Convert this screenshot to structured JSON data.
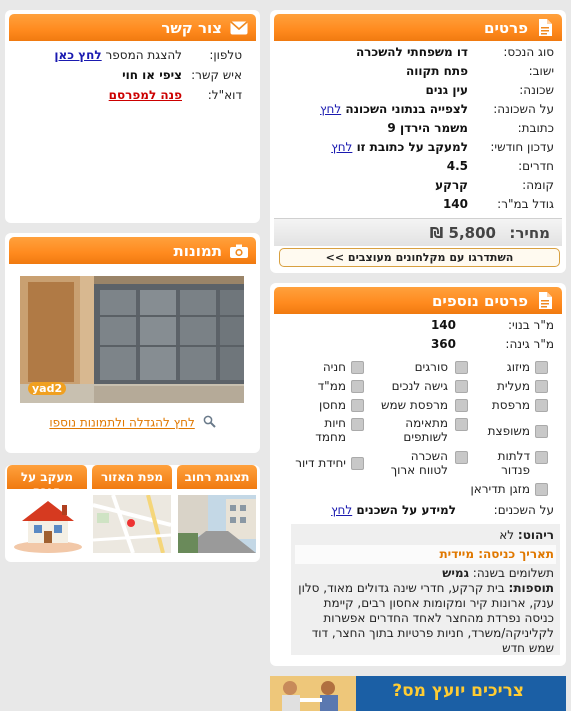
{
  "details": {
    "title": "פרטים",
    "rows": [
      {
        "label": "סוג הנכס:",
        "value": "דו משפחתי להשכרה"
      },
      {
        "label": "ישוב:",
        "value": "פתח תקווה"
      },
      {
        "label": "שכונה:",
        "value": "עין גנים"
      },
      {
        "label": "על השכונה:",
        "value": "לצפייה בנתוני השכונה",
        "link": "לחץ"
      },
      {
        "label": "כתובת:",
        "value": "משמר הירדן 9"
      },
      {
        "label": "עדכון חודשי:",
        "value": "למעקב על כתובת זו",
        "link": "לחץ"
      },
      {
        "label": "חדרים:",
        "value": "4.5"
      },
      {
        "label": "קומה:",
        "value": "קרקע"
      },
      {
        "label": "גודל במ\"ר:",
        "value": "140"
      }
    ],
    "price_label": "מחיר:",
    "price_value": "5,800 ₪",
    "upgrade_link": "השתדרגו עם מקלחונים מעוצבים >>"
  },
  "contact": {
    "title": "צור קשר",
    "phone_label": "טלפון:",
    "phone_text": "להצגת המספר",
    "phone_link": "לחץ כאן",
    "person_label": "איש קשר:",
    "person_value": "ציפי או חוי",
    "email_label": "דוא\"ל:",
    "email_link": "פנה למפרסם"
  },
  "photos": {
    "title": "תמונות",
    "watermark": "yad2",
    "enlarge_link": "לחץ להגדלה ולתמונות נוספו"
  },
  "tabs": [
    {
      "label": "תצוגת רחוב"
    },
    {
      "label": "מפת האזור"
    },
    {
      "label": "מעקב על הנכס"
    }
  ],
  "more": {
    "title": "פרטים נוספים",
    "built_label": "מ\"ר בנוי:",
    "built_value": "140",
    "garden_label": "מ\"ר גינה:",
    "garden_value": "360",
    "features": [
      [
        "מיזוג",
        "סורגים",
        "חניה"
      ],
      [
        "מעלית",
        "גישה לנכים",
        "ממ\"ד"
      ],
      [
        "מרפסת",
        "מרפסת שמש",
        "מחסן"
      ],
      [
        "משופצת",
        "מתאימה לשותפים",
        "חיות מחמד"
      ],
      [
        "דלתות פנדור",
        "השכרה לטווח ארוך",
        "יחידת דיור"
      ],
      [
        "מזגן תדיראן",
        "",
        ""
      ]
    ],
    "residents_label": "על השכנים:",
    "residents_value": "למידע על השכנים",
    "residents_link": "לחץ"
  },
  "info": {
    "furniture_label": "ריהוט:",
    "furniture_value": "לא",
    "entry_label": "תאריך כניסה:",
    "entry_value": "מיידית",
    "payments_label": "תשלומים בשנה:",
    "payments_value": "גמיש",
    "extras_label": "תוספות:",
    "extras_value": "בית קרקע, חדרי שינה גדולים מאוד, סלון ענק, ארונות קיר ומקומות אחסון רבים, קיימת כניסה נפרדת מהחצר לאחד החדרים אפשרות לקליניקה/משרד, חניות פרטיות בתוך החצר, דוד שמש חדש"
  },
  "banner": {
    "text": "צריכים יועץ מס?"
  },
  "colors": {
    "accent": "#ff8a1e",
    "link": "#1a1ab0",
    "red_link": "#cc0000",
    "orange_text": "#e07800"
  }
}
